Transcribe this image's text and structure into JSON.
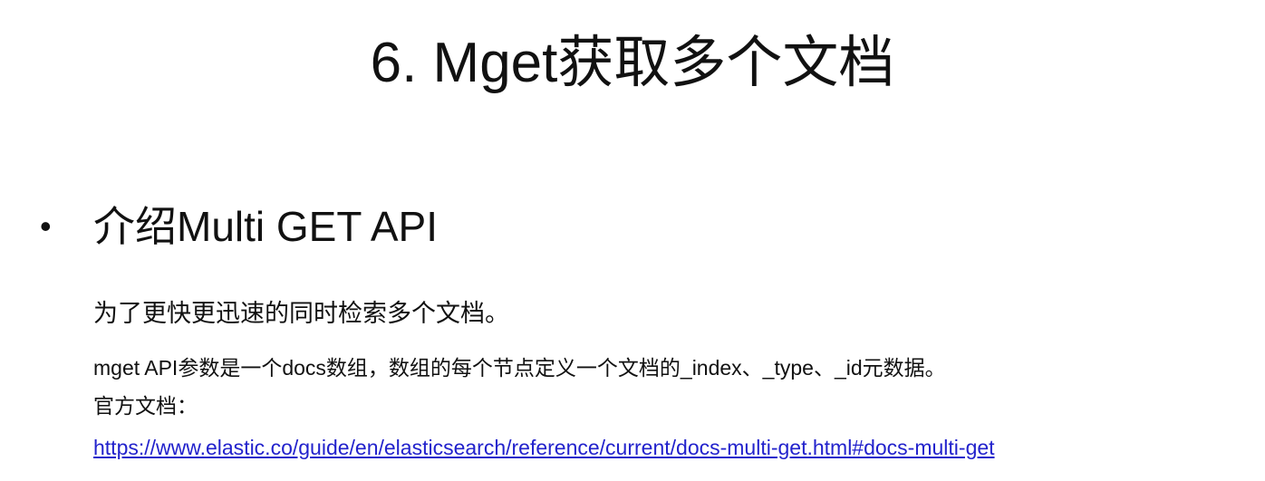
{
  "title": "6. Mget获取多个文档",
  "bullet": "•",
  "heading": "介绍Multi GET API",
  "lines": [
    "为了更快更迅速的同时检索多个文档。",
    "mget API参数是一个docs数组，数组的每个节点定义一个文档的_index、_type、_id元数据。",
    "官方文档："
  ],
  "link": "https://www.elastic.co/guide/en/elasticsearch/reference/current/docs-multi-get.html#docs-multi-get",
  "colors": {
    "link": "#2222cc",
    "text": "#111111"
  }
}
